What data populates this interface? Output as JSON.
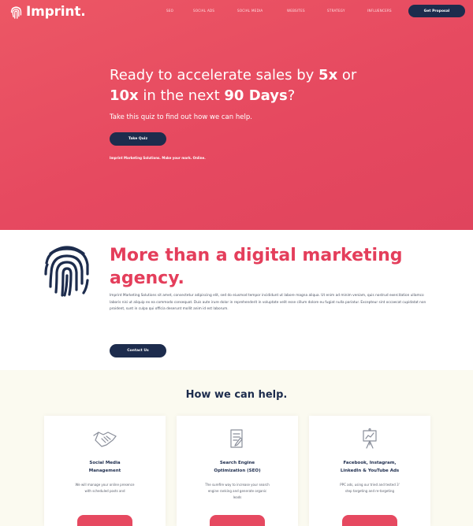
{
  "brand": {
    "name": "Imprint."
  },
  "nav": {
    "items": [
      "SEO",
      "SOCIAL ADS",
      "SOCIAL MEDIA",
      "WEBSITES",
      "STRATEGY",
      "INFLUENCERS"
    ],
    "cta": "Get Proposal"
  },
  "hero": {
    "title_parts": [
      "Ready to accelerate sales by ",
      "5x",
      " or ",
      "10x",
      " in the next ",
      "90 Days",
      "?"
    ],
    "subtitle": "Take this quiz to find out how we can help.",
    "button": "Take Quiz",
    "tagline_lead": "Imprint Marketing Solutions. Make your mark. ",
    "tagline_bold": "Online."
  },
  "about": {
    "title": "More than a digital marketing agency.",
    "body": "Imprint Marketing Solutions sit amet, consectetur adipiscing elit, sed do eiusmod tempor incididunt ut labore magna aliqua. Ut enim ad minim veniam, quis nostrud exercitation ullamco laboris nisi ut aliquip ex ea commodo consequat. Duis aute irure dolor in reprehenderit in voluptate velit esse cillum dolore eu fugiat nulla pariatur. Excepteur sint occaecat cupidatat non proident, sunt in culpa qui officia deserunt mollit anim id est laborum.",
    "button": "Contact Us"
  },
  "services": {
    "title": "How we can help.",
    "cards": [
      {
        "icon": "handshake-icon",
        "title_line1": "Social Media",
        "title_line2": "Management",
        "desc_line1": "We will manage your online presence",
        "desc_line2": "with scheduled posts and"
      },
      {
        "icon": "document-edit-icon",
        "title_line1": "Search Engine",
        "title_line2": "Optimization (SEO)",
        "desc_line1": "The surefire way to increase your search",
        "desc_line2": "engine ranking and generate organic",
        "desc_line3": "leads"
      },
      {
        "icon": "presentation-board-icon",
        "title_line1": "Facebook, Instagram,",
        "title_line2": "LinkedIn & YouTube Ads",
        "desc_line1": "PPC ads, using our tried and tested 3'",
        "desc_line2": "step targeting and re-targeting"
      }
    ]
  },
  "colors": {
    "primary": "#e64960",
    "navy": "#1d2c4d",
    "accent_text": "#e43e5b",
    "cream": "#fbfaf0"
  }
}
